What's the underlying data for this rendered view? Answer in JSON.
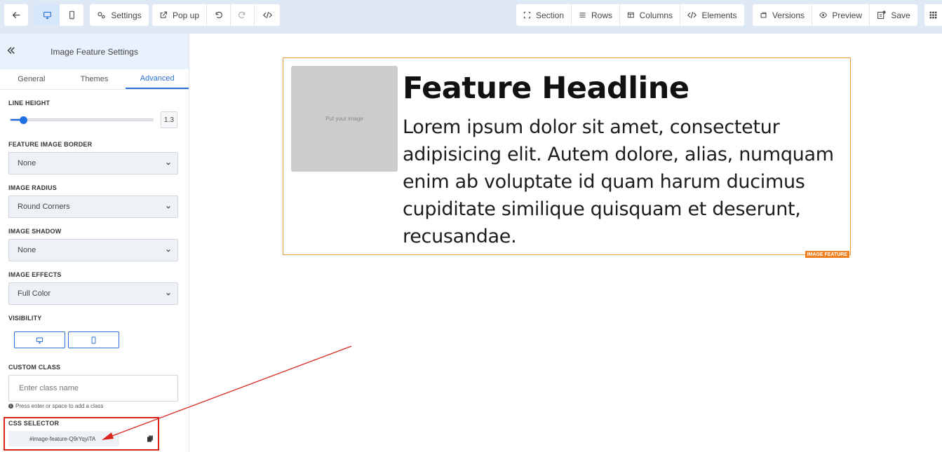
{
  "toolbar": {
    "left": {
      "back": "back-arrow-icon",
      "desktop": "desktop-icon",
      "mobile": "mobile-icon",
      "settings_label": "Settings",
      "popup_label": "Pop up",
      "undo": "undo-icon",
      "redo": "redo-icon",
      "code": "code-icon"
    },
    "right": {
      "section_label": "Section",
      "rows_label": "Rows",
      "columns_label": "Columns",
      "elements_label": "Elements",
      "versions_label": "Versions",
      "preview_label": "Preview",
      "save_label": "Save"
    }
  },
  "sidebar": {
    "title": "Image Feature Settings",
    "tabs": [
      {
        "label": "General"
      },
      {
        "label": "Themes"
      },
      {
        "label": "Advanced"
      }
    ],
    "active_tab": "Advanced",
    "line_height": {
      "label": "LINE HEIGHT",
      "value": "1.3",
      "fraction": 0.09
    },
    "feature_image_border": {
      "label": "FEATURE IMAGE BORDER",
      "value": "None"
    },
    "image_radius": {
      "label": "IMAGE RADIUS",
      "value": "Round Corners"
    },
    "image_shadow": {
      "label": "IMAGE SHADOW",
      "value": "None"
    },
    "image_effects": {
      "label": "IMAGE EFFECTS",
      "value": "Full Color"
    },
    "visibility": {
      "label": "VISIBILITY"
    },
    "custom_class": {
      "label": "CUSTOM CLASS",
      "placeholder": "Enter class name",
      "hint": "Press enter or space to add a class"
    },
    "css_selector": {
      "label": "CSS SELECTOR",
      "value": "#image-feature-Q9rYqyiTA"
    }
  },
  "canvas": {
    "image_placeholder": "Put your image",
    "headline": "Feature Headline",
    "body": "Lorem ipsum dolor sit amet, consectetur adipisicing elit. Autem dolore, alias, numquam enim ab voluptate id quam harum ducimus cupiditate similique quisquam et deserunt, recusandae.",
    "tag": "IMAGE FEATURE"
  },
  "colors": {
    "accent": "#2a6fd6",
    "highlight": "#d9261c",
    "element_border": "#e79a3c"
  }
}
